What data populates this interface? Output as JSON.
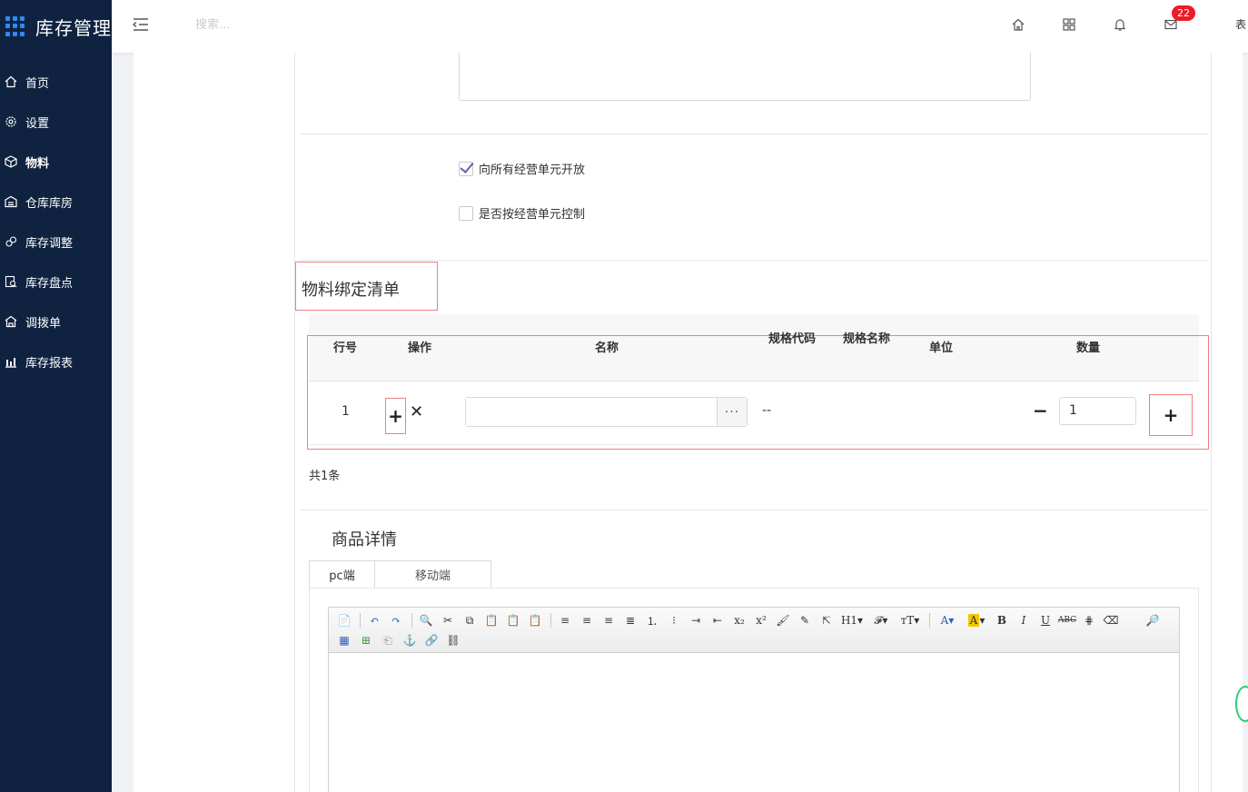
{
  "app": {
    "title": "库存管理"
  },
  "sidebar": {
    "items": [
      {
        "label": "首页",
        "icon": "home-icon"
      },
      {
        "label": "设置",
        "icon": "gear-icon"
      },
      {
        "label": "物料",
        "icon": "cube-icon",
        "active": true
      },
      {
        "label": "仓库库房",
        "icon": "warehouse-icon"
      },
      {
        "label": "库存调整",
        "icon": "adjust-icon"
      },
      {
        "label": "库存盘点",
        "icon": "inventory-icon"
      },
      {
        "label": "调拨单",
        "icon": "transfer-icon"
      },
      {
        "label": "库存报表",
        "icon": "chart-icon"
      }
    ]
  },
  "header": {
    "search_placeholder": "搜索...",
    "badge_count": "22",
    "edge_glyph": "表"
  },
  "form": {
    "open_all_label": "向所有经营单元开放",
    "open_all_checked": true,
    "control_label": "是否按经营单元控制",
    "control_checked": false
  },
  "binding": {
    "title": "物料绑定清单",
    "columns": {
      "row": "行号",
      "op": "操作",
      "name": "名称",
      "spec_code": "规格代码",
      "spec_name": "规格名称",
      "unit": "单位",
      "qty": "数量"
    },
    "rows": [
      {
        "row": "1",
        "name": "",
        "spec": "--",
        "qty": "1"
      }
    ],
    "total": "共1条"
  },
  "details": {
    "title": "商品详情",
    "tabs": [
      "pc端",
      "移动端"
    ]
  }
}
